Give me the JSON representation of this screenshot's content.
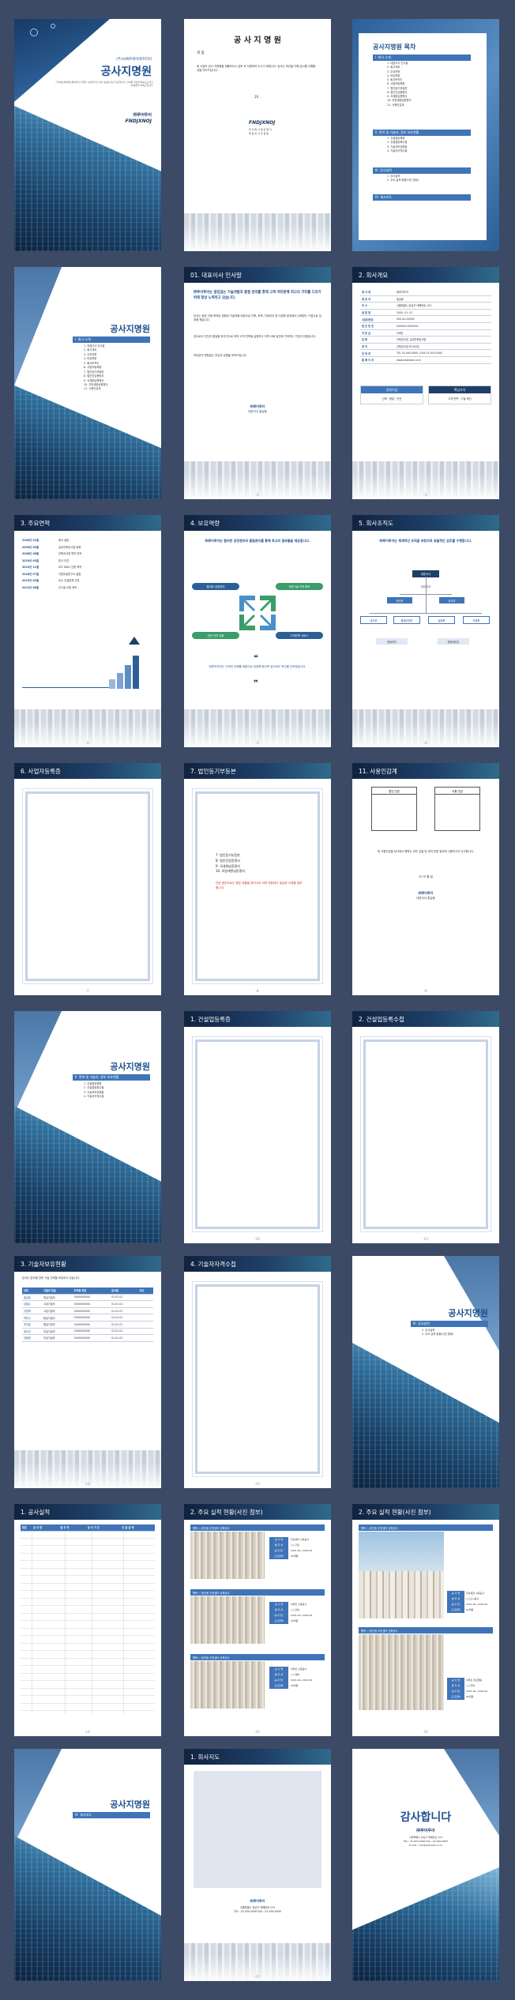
{
  "cover": {
    "company": "(주)씨에프에이에프티어",
    "title": "공사지명원",
    "desc": "(주)에프제이엑스에이치가 진행한 시공실적 및 회사 정보를 담은 자료입니다. 신뢰와 기술을 바탕으로 최고의 품질을 약속드립니다.",
    "logo_kr": "㈜루어투어",
    "logo_en": "FNDJXNOJ"
  },
  "letter": {
    "title": "공 사 지 명 원",
    "to": "귀 중",
    "body": "위 사업자 공사 지명원을 제출하오니 검토 후 지명하여 주시기 바랍니다. 당사는 최선을 다해 공사를 수행할 것을 약속드립니다.",
    "date": "20 .",
    "logo": "FNDJXNOJ",
    "logo_sub1": "주 식 회 사 에 프 엔 디",
    "logo_sub2": "대 표 이 사 홍 길 동"
  },
  "toc": {
    "title": "공사지명원 목차",
    "sections": [
      {
        "num": "I",
        "label": "회사 소개",
        "items": [
          "1. 대표이사 인사말",
          "2. 회사개요",
          "3. 주요연혁",
          "4. 보유역량",
          "5. 회사조직도",
          "6. 사업자등록증",
          "7. 법인등기부등본",
          "8. 법인인감증명서",
          "9. 국세완납증명서",
          "10. 지방세완납증명서",
          "11. 사용인감계"
        ]
      },
      {
        "num": "II",
        "label": "면허 및 기술자, 장비 보유현황",
        "items": [
          "1. 건설업등록증",
          "2. 건설업등록수첩",
          "3. 기술자보유현황",
          "4. 기술자자격수첩"
        ]
      },
      {
        "num": "III",
        "label": "공사실적",
        "items": [
          "1. 공사실적",
          "2. 주요 실적 현황(사진 첨부)"
        ]
      },
      {
        "num": "IV",
        "label": "회사지도",
        "items": []
      }
    ]
  },
  "sec1": {
    "title": "공사지명원",
    "num": "I",
    "label": "회사 소개",
    "items": [
      "1. 대표이사 인사말",
      "2. 회사개요",
      "3. 주요연혁",
      "4. 보유역량",
      "5. 회사조직도",
      "6. 사업자등록증",
      "7. 법인등기부등본",
      "8. 법인인감증명서",
      "9. 국세완납증명서",
      "10. 지방세완납증명서",
      "11. 사용인감계"
    ]
  },
  "greeting": {
    "header": "01. 대표이사 인사말",
    "lead": "㈜루어투어는 끊임없는 기술개발과 품질 관리를 통해 고객 여러분께 최고의 가치를 드리기 위해 항상 노력하고 있습니다.",
    "p1": "당사는 창립 이래 축적된 경험과 기술력을 바탕으로 건축, 토목, 인테리어 등 다양한 분야에서 신뢰받는 기업으로 성장해 왔습니다.",
    "p2": "앞으로도 안전과 품질을 최우선으로 하여 고객 만족을 실현하고 지역 사회 발전에 기여하는 기업이 되겠습니다.",
    "p3": "여러분의 변함없는 관심과 성원을 부탁드립니다.",
    "sign1": "㈜루어투어",
    "sign2": "대표이사 홍길동"
  },
  "overview": {
    "header": "2. 회사개요",
    "rows": [
      {
        "k": "회 사 명",
        "v": "㈜루어투어"
      },
      {
        "k": "대 표 자",
        "v": "홍길동"
      },
      {
        "k": "주 소",
        "v": "서울특별시 강남구 테헤란로 123"
      },
      {
        "k": "설 립 일",
        "v": "2000. 01. 01"
      },
      {
        "k": "사업자번호",
        "v": "000-00-00000"
      },
      {
        "k": "법 인 번 호",
        "v": "000000-0000000"
      },
      {
        "k": "자 본 금",
        "v": "5억원"
      },
      {
        "k": "업 종",
        "v": "건축공사업, 실내건축공사업"
      },
      {
        "k": "면 허",
        "v": "건축공사업 제 000호"
      },
      {
        "k": "연 락 처",
        "v": "TEL 02-000-0000 / FAX 02-000-0000"
      },
      {
        "k": "홈 페 이 지",
        "v": "www.example.co.kr"
      }
    ],
    "box1_title": "경영이념",
    "box1_text": "신뢰 · 품질 · 안전",
    "box2_title": "핵심가치",
    "box2_text": "고객 만족 · 기술 혁신"
  },
  "history": {
    "header": "3. 주요연혁",
    "rows": [
      {
        "y": "2000년 01월",
        "t": "회사 설립"
      },
      {
        "y": "2003년 05월",
        "t": "실내건축공사업 등록"
      },
      {
        "y": "2006년 08월",
        "t": "건축공사업 면허 취득"
      },
      {
        "y": "2010년 03월",
        "t": "본사 이전"
      },
      {
        "y": "2013년 11월",
        "t": "ISO 9001 인증 획득"
      },
      {
        "y": "2016년 07월",
        "t": "기업부설연구소 설립"
      },
      {
        "y": "2019년 02월",
        "t": "우수 건설업체 선정"
      },
      {
        "y": "2021년 06월",
        "t": "신기술 인증 획득"
      }
    ]
  },
  "capability": {
    "header": "4. 보유역량",
    "lead": "㈜루어투어는 철저한 공정관리와 품질관리를 통해 최고의 결과물을 제공합니다.",
    "tl": "철저한 공정관리",
    "tr": "전문기술 인력 확보",
    "bl": "안전 관리 강화",
    "br": "고객만족 서비스",
    "quote": "㈜루어투어는 고객의 신뢰를 바탕으로 성장해 왔으며 앞으로도 최선을 다하겠습니다."
  },
  "org": {
    "header": "5. 회사조직도",
    "lead": "㈜루어투어는 체계적인 조직을 바탕으로 효율적인 업무를 수행합니다.",
    "top": "대표이사",
    "mid": "관리이사",
    "l2": [
      "관리부",
      "공무부"
    ],
    "l3": [
      "공사부",
      "품질안전부",
      "설계부",
      "자재부"
    ],
    "l4": [
      "현장관리",
      "현장대리인"
    ]
  },
  "bizreg": {
    "header": "6. 사업자등록증"
  },
  "corp": {
    "header": "7. 법인등기부등본",
    "items": [
      "7. 법인등기부등본",
      "8. 법인인감증명서",
      "9. 국세완납증명서",
      "10. 지방세완납증명서"
    ],
    "note": "관련 증빙자료는 원본 제출을 원칙으로 하며 법원에서 발급한 서류를 첨부합니다."
  },
  "seal": {
    "header": "11. 사용인감계",
    "box1": "법인 인감",
    "box2": "사용 인감",
    "text": "위 사용인감을 당사에서 행하는 모든 입찰 및 계약 관련 업무에 사용하고자 신고합니다.",
    "date": "20 년 월 일",
    "company": "㈜루어투어",
    "ceo": "대표이사 홍길동"
  },
  "sec2": {
    "title": "공사지명원",
    "num": "II",
    "label": "면허 및 기술자, 장비 보유현황",
    "items": [
      "1. 건설업등록증",
      "2. 건설업등록수첩",
      "3. 기술자보유현황",
      "4. 기술자자격수첩"
    ]
  },
  "license": {
    "header": "1. 건설업등록증"
  },
  "licbook": {
    "header": "2. 건설업등록수첩"
  },
  "engineers": {
    "header": "3. 기술자보유현황",
    "lead": "당사는 분야별 전문 기술 인력을 보유하고 있습니다.",
    "cols": [
      "성명",
      "기술자 등급",
      "자격증 번호",
      "입사일",
      "비고"
    ],
    "rows": [
      [
        "홍길동",
        "특급기술자",
        "0000000000",
        "01.01.01",
        ""
      ],
      [
        "김철수",
        "고급기술자",
        "0000000000",
        "01.01.01",
        ""
      ],
      [
        "이영희",
        "고급기술자",
        "0000000000",
        "01.01.01",
        ""
      ],
      [
        "박민수",
        "중급기술자",
        "0000000000",
        "01.01.01",
        ""
      ],
      [
        "최지훈",
        "중급기술자",
        "0000000000",
        "01.01.01",
        ""
      ],
      [
        "정수진",
        "초급기술자",
        "0000000000",
        "01.01.01",
        ""
      ],
      [
        "강동원",
        "초급기술자",
        "0000000000",
        "01.01.01",
        ""
      ]
    ]
  },
  "engbook": {
    "header": "4. 기술자자격수첩"
  },
  "sec3": {
    "title": "공사지명원",
    "num": "III",
    "label": "공사실적",
    "items": [
      "1. 공사실적",
      "2. 주요 실적 현황(사진 첨부)"
    ]
  },
  "records": {
    "header": "1. 공사실적",
    "cols": [
      "번호",
      "공 사 명",
      "발 주 처",
      "공 사 기 간",
      "도 급 금 액"
    ]
  },
  "photos1": {
    "header": "2. 주요 실적 현황(사진 첨부)",
    "items": [
      {
        "title": "행복 ○ 동인동 주민센터 신축공사",
        "f": [
          "공 사 명",
          "발 주 처",
          "공사기간",
          "도급금액"
        ],
        "v": [
          "주민센터 신축공사",
          "○○구청",
          "2021.00~2022.00",
          "00억원"
        ]
      },
      {
        "title": "행복 ○ 동인동 주민센터 신축공사",
        "f": [
          "공 사 명",
          "발 주 처",
          "공사기간",
          "도급금액"
        ],
        "v": [
          "아파트 신축공사",
          "○○건설",
          "2021.00~2022.00",
          "00억원"
        ]
      },
      {
        "title": "행복 ○ 동인동 주민센터 신축공사",
        "f": [
          "공 사 명",
          "발 주 처",
          "공사기간",
          "도급금액"
        ],
        "v": [
          "아파트 신축공사",
          "○○개발",
          "2021.00~2022.00",
          "00억원"
        ]
      }
    ]
  },
  "photos2": {
    "header": "2. 주요 실적 현황(사진 첨부)",
    "items": [
      {
        "title": "행복 ○ 동인동 주민센터 신축공사",
        "f": [
          "공 사 명",
          "발 주 처",
          "공사기간",
          "도급금액"
        ],
        "v": [
          "주상복합 신축공사",
          "○○도시공사",
          "2021.00~2022.00",
          "00억원"
        ]
      },
      {
        "title": "행복 ○ 동인동 주민센터 신축공사",
        "f": [
          "공 사 명",
          "발 주 처",
          "공사기간",
          "도급금액"
        ],
        "v": [
          "아파트 리모델링",
          "○○주택",
          "2021.00~2022.00",
          "00억원"
        ]
      }
    ]
  },
  "sec4": {
    "title": "공사지명원",
    "num": "IV",
    "label": "회사지도"
  },
  "map": {
    "header": "1. 회사지도",
    "company": "㈜루어투어",
    "addr": "서울특별시 강남구 테헤란로 123",
    "tel": "TEL : 02-000-0000  FAX : 02-000-0000"
  },
  "thanks": {
    "title": "감사합니다",
    "company": "㈜루어투어",
    "addr": "서울특별시 강남구 테헤란로 123",
    "tel": "TEL : 02-000-0000  FAX : 02-000-0000",
    "mail": "E-mail : info@example.co.kr"
  },
  "page_numbers": [
    "",
    "",
    "",
    "-1-",
    "-2-",
    "-3-",
    "-4-",
    "-5-",
    "-6-",
    "-7-",
    "-8-",
    "-9-",
    "",
    "-10-",
    "-11-",
    "-12-",
    "-13-",
    "",
    "-14-",
    "-15-",
    "-16-",
    "",
    "-17-",
    ""
  ]
}
